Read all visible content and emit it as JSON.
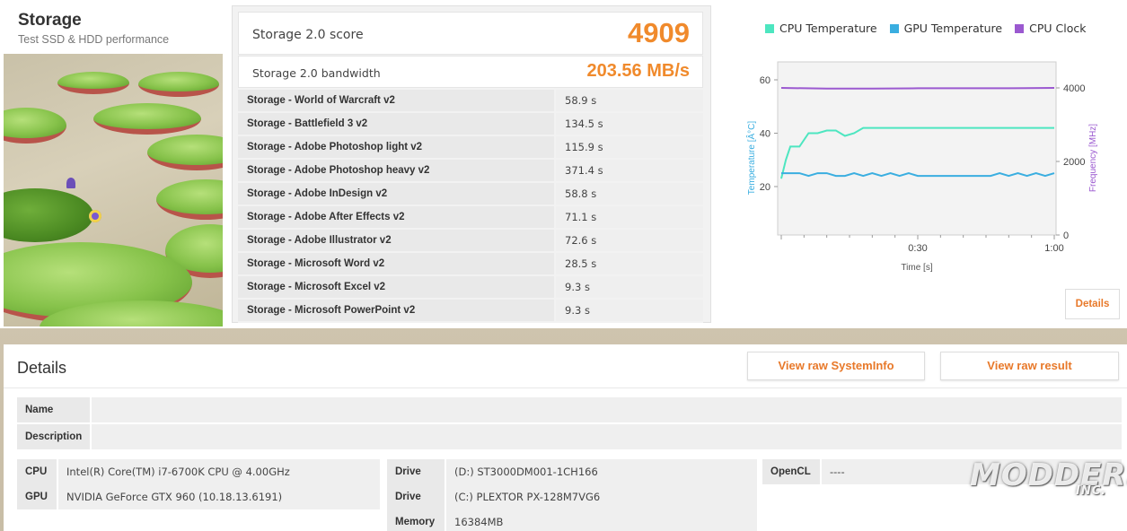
{
  "header": {
    "title": "Storage",
    "subtitle": "Test SSD & HDD performance"
  },
  "score": {
    "label": "Storage 2.0 score",
    "value": "4909",
    "bandwidth_label": "Storage 2.0 bandwidth",
    "bandwidth_value": "203.56 MB/s"
  },
  "tests": [
    {
      "name": "Storage - World of Warcraft v2",
      "time": "58.9 s"
    },
    {
      "name": "Storage - Battlefield 3 v2",
      "time": "134.5 s"
    },
    {
      "name": "Storage - Adobe Photoshop light v2",
      "time": "115.9 s"
    },
    {
      "name": "Storage - Adobe Photoshop heavy v2",
      "time": "371.4 s"
    },
    {
      "name": "Storage - Adobe InDesign v2",
      "time": "58.8 s"
    },
    {
      "name": "Storage - Adobe After Effects v2",
      "time": "71.1 s"
    },
    {
      "name": "Storage - Adobe Illustrator v2",
      "time": "72.6 s"
    },
    {
      "name": "Storage - Microsoft Word v2",
      "time": "28.5 s"
    },
    {
      "name": "Storage - Microsoft Excel v2",
      "time": "9.3 s"
    },
    {
      "name": "Storage - Microsoft PowerPoint v2",
      "time": "9.3 s"
    }
  ],
  "chart_data": {
    "type": "line",
    "xlabel": "Time [s]",
    "ylabel": "Temperature [Â°C]",
    "y2label": "Frequency [MHz]",
    "xlim": [
      0,
      60
    ],
    "ylim": [
      0,
      60
    ],
    "y2lim": [
      0,
      4000
    ],
    "x_ticks": [
      "0:30",
      "1:00"
    ],
    "y_ticks": [
      "20",
      "40",
      "60"
    ],
    "y2_ticks": [
      "0",
      "2000",
      "4000"
    ],
    "legend_position": "top",
    "series": [
      {
        "name": "CPU Temperature",
        "color": "#4de6c0",
        "axis": "left",
        "x": [
          0,
          1,
          2,
          4,
          6,
          8,
          10,
          12,
          14,
          16,
          18,
          20,
          22,
          30,
          40,
          50,
          60
        ],
        "y": [
          23,
          30,
          35,
          35,
          40,
          40,
          41,
          41,
          39,
          40,
          42,
          42,
          42,
          42,
          42,
          42,
          42
        ]
      },
      {
        "name": "GPU Temperature",
        "color": "#3aaee0",
        "axis": "left",
        "x": [
          0,
          4,
          6,
          8,
          10,
          12,
          14,
          16,
          18,
          20,
          22,
          24,
          26,
          28,
          30,
          40,
          46,
          48,
          50,
          52,
          54,
          56,
          58,
          60
        ],
        "y": [
          25,
          25,
          24,
          25,
          25,
          24,
          24,
          25,
          24,
          25,
          24,
          25,
          24,
          25,
          24,
          24,
          24,
          25,
          24,
          25,
          24,
          25,
          24,
          25
        ]
      },
      {
        "name": "CPU Clock",
        "color": "#9b59d0",
        "axis": "right",
        "x": [
          0,
          10,
          20,
          30,
          40,
          50,
          60
        ],
        "y": [
          4000,
          3980,
          3980,
          3990,
          3990,
          3990,
          4000
        ]
      }
    ]
  },
  "chart_panel": {
    "details_label": "Details"
  },
  "details": {
    "title": "Details",
    "view_systeminfo": "View raw SystemInfo",
    "view_result": "View raw result",
    "name_label": "Name",
    "name_value": "",
    "description_label": "Description",
    "description_value": "",
    "cpu_label": "CPU",
    "cpu_value": "Intel(R) Core(TM) i7-6700K CPU @ 4.00GHz",
    "gpu_label": "GPU",
    "gpu_value": "NVIDIA GeForce GTX 960 (10.18.13.6191)",
    "drive1_label": "Drive",
    "drive1_value": "(D:) ST3000DM001-1CH166",
    "drive2_label": "Drive",
    "drive2_value": "(C:) PLEXTOR PX-128M7VG6",
    "memory_label": "Memory",
    "memory_value": "16384MB",
    "opencl_label": "OpenCL",
    "opencl_value": "----"
  },
  "watermark": {
    "text": "MODDERS",
    "sub": "INC."
  },
  "colors": {
    "accent": "#f08a2c",
    "cpu_temp": "#4de6c0",
    "gpu_temp": "#3aaee0",
    "cpu_clock": "#9b59d0"
  }
}
